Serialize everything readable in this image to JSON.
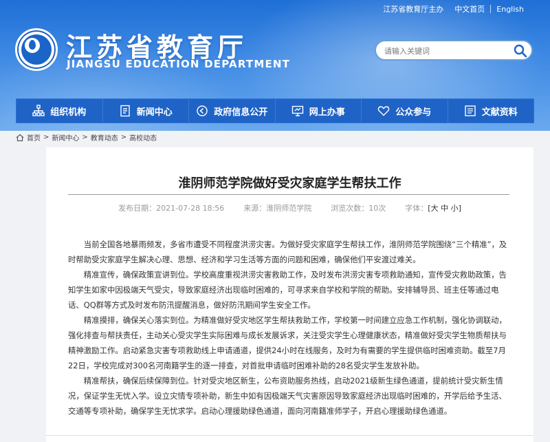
{
  "top_links": {
    "host": "江苏省教育厅主办",
    "home": "中文首页",
    "english": "English"
  },
  "site": {
    "title": "江苏省教育厅",
    "subtitle": "JIANGSU EDUCATION DEPARTMENT"
  },
  "search": {
    "placeholder": "请输入关键词"
  },
  "nav": {
    "items": [
      {
        "label": "组织机构",
        "icon": "org-icon"
      },
      {
        "label": "新闻中心",
        "icon": "news-icon"
      },
      {
        "label": "政府信息公开",
        "icon": "info-icon"
      },
      {
        "label": "网上办事",
        "icon": "service-icon"
      },
      {
        "label": "公众参与",
        "icon": "heart-icon"
      },
      {
        "label": "文献资料",
        "icon": "docs-icon"
      }
    ]
  },
  "breadcrumb": {
    "items": [
      "首页",
      "新闻中心",
      "教育动态",
      "高校动态"
    ],
    "sep": ">"
  },
  "article": {
    "title": "淮阴师范学院做好受灾家庭学生帮扶工作",
    "publish_time": "发布日期：2021-07-28 18:56",
    "source": "来源：淮阴师范学院",
    "views": "浏览次数：10次",
    "font_label": "字体：",
    "font_open": "[",
    "font_large": "大",
    "font_mid": "中",
    "font_small": "小",
    "font_close": "]",
    "paragraphs": [
      "当前全国各地暴雨频发，多省市遭受不同程度洪涝灾害。为做好受灾家庭学生帮扶工作，淮阴师范学院围绕“三个精准”，及时帮助受灾家庭学生解决心理、思想、经济和学习生活等方面的问题和困难，确保他们平安渡过难关。",
      "精准宣传，确保政策宣讲到位。学校高度重视洪涝灾害救助工作，及时发布洪涝灾害专项救助通知，宣传受灾救助政策，告知学生如家中因极端天气受灾，导致家庭经济出现临时困难的，可寻求来自学校和学院的帮助。安排辅导员、班主任等通过电话、QQ群等方式及时发布防汛提醒消息，做好防汛期间学生安全工作。",
      "精准摸排，确保关心落实到位。为精准做好受灾地区学生帮扶救助工作，学校第一时间建立应急工作机制，强化协调联动，强化排查与帮扶责任，主动关心受灾学生实际困难与成长发展诉求，关注受灾学生心理健康状态，精准做好受灾学生物质帮扶与精神激励工作。启动紧急灾害专项救助线上申请通道，提供24小时在线服务，及时为有需要的学生提供临时困难资助。截至7月22日，学校完成对300名河南籍学生的逐一排查，对首批申请临时困难补助的28名受灾学生发放补助。",
      "精准帮扶，确保后续保障到位。针对受灾地区新生，公布资助服务热线，启动2021级新生绿色通道，提前统计受灾新生情况，保证学生无忧入学。设立灾情专项补助，新生中如有因极端天气灾害原因导致家庭经济出现临时困难的，开学后给予生活、交通等专项补助，确保学生无忧求学。启动心理援助绿色通道，面向河南籍准师学子，开启心理援助绿色通道。"
    ]
  },
  "colors": {
    "nav_bg": "#1f63c6",
    "header_top": "#1e6fd6",
    "header_bottom": "#6aa9ee"
  }
}
